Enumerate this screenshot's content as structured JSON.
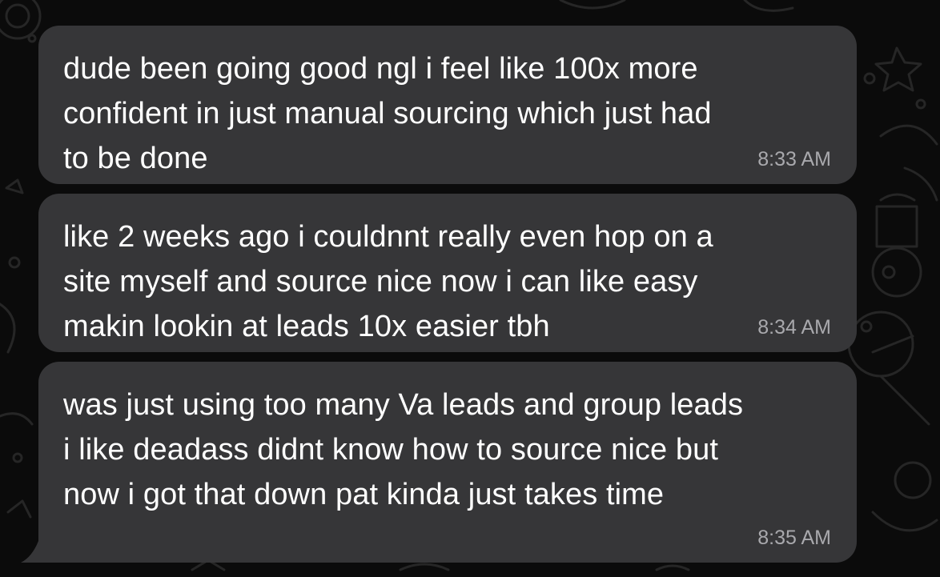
{
  "chat": {
    "messages": [
      {
        "text": "dude been going good ngl i feel like 100x more\nconfident in just manual sourcing which just had\nto be done",
        "time": "8:33 AM"
      },
      {
        "text": "like 2 weeks ago i couldnnt really even hop on a\nsite myself and source nice now i can like easy\nmakin lookin at leads 10x easier tbh",
        "time": "8:34 AM"
      },
      {
        "text": "was just using too many Va leads and group leads\ni like deadass didnt know how to source nice but\nnow i got that down pat kinda just takes time",
        "time": "8:35 AM"
      }
    ]
  },
  "colors": {
    "background": "#0b0b0b",
    "bubble": "#363638",
    "text": "#ffffff",
    "timestamp": "#a9a9ad"
  }
}
